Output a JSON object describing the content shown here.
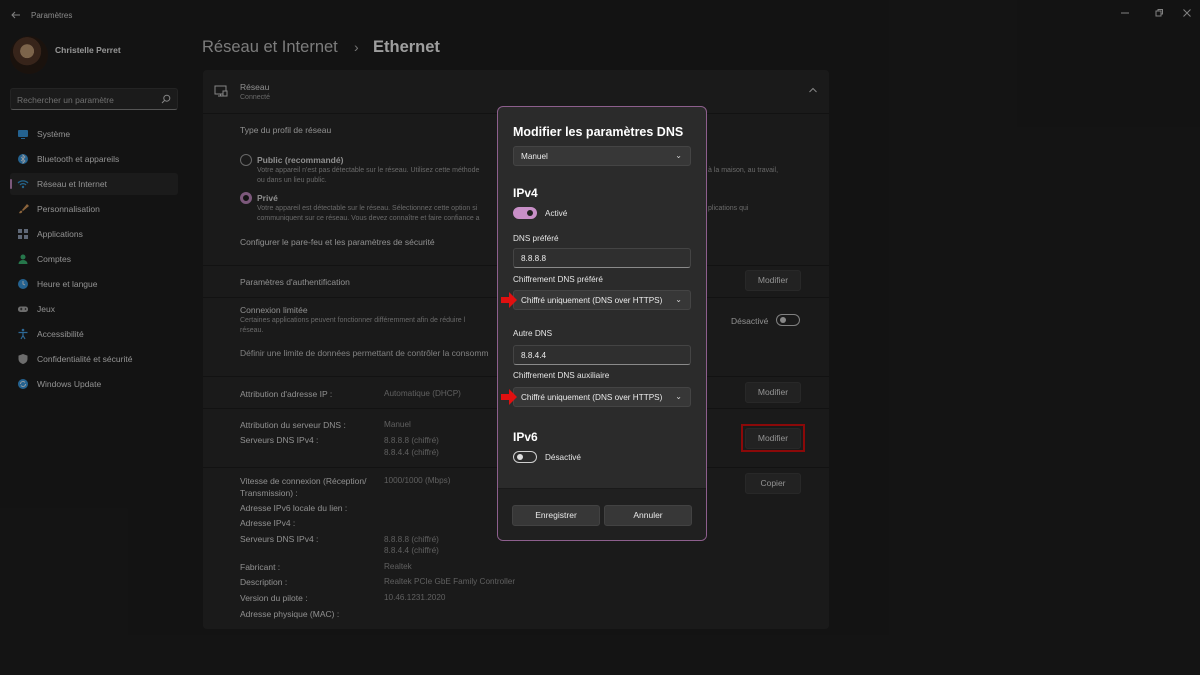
{
  "window": {
    "title": "Paramètres"
  },
  "user": {
    "name": "Christelle Perret"
  },
  "search": {
    "placeholder": "Rechercher un paramètre"
  },
  "sidebar": {
    "items": [
      {
        "label": "Système",
        "icon": "system-icon",
        "color": "#3a9fe8"
      },
      {
        "label": "Bluetooth et appareils",
        "icon": "bluetooth-icon",
        "color": "#3a9fe8"
      },
      {
        "label": "Réseau et Internet",
        "icon": "wifi-icon",
        "color": "#3aa3e3"
      },
      {
        "label": "Personnalisation",
        "icon": "brush-icon",
        "color": "#e0a060"
      },
      {
        "label": "Applications",
        "icon": "apps-icon",
        "color": "#9aa8c0"
      },
      {
        "label": "Comptes",
        "icon": "person-icon",
        "color": "#3ec07a"
      },
      {
        "label": "Heure et langue",
        "icon": "globe-clock-icon",
        "color": "#3a9fe8"
      },
      {
        "label": "Jeux",
        "icon": "gamepad-icon",
        "color": "#b0b0b0"
      },
      {
        "label": "Accessibilité",
        "icon": "accessibility-icon",
        "color": "#4aa8f0"
      },
      {
        "label": "Confidentialité et sécurité",
        "icon": "shield-icon",
        "color": "#b0b0b0"
      },
      {
        "label": "Windows Update",
        "icon": "update-icon",
        "color": "#3a9fe8"
      }
    ],
    "active_index": 2
  },
  "header": {
    "breadcrumb_parent": "Réseau et Internet",
    "separator": "›",
    "current": "Ethernet"
  },
  "network": {
    "title": "Réseau",
    "status": "Connecté",
    "profile_heading": "Type du profil de réseau",
    "public_label": "Public (recommandé)",
    "public_desc1": "Votre appareil n'est pas détectable sur le réseau. Utilisez cette méthode",
    "public_desc1_tail": "à la maison, au travail,",
    "public_desc2": "ou dans un lieu public.",
    "private_label": "Privé",
    "private_desc1": "Votre appareil est détectable sur le réseau. Sélectionnez cette option si",
    "private_desc1_tail": "plications qui",
    "private_desc2": "communiquent sur ce réseau. Vous devez connaître et faire confiance a",
    "firewall_link": "Configurer le pare-feu et les paramètres de sécurité",
    "auth_label": "Paramètres d'authentification",
    "auth_button": "Modifier",
    "metered_label": "Connexion limitée",
    "metered_desc1": "Certaines applications peuvent fonctionner différemment afin de réduire l",
    "metered_desc2": "réseau.",
    "metered_state": "Désactivé",
    "data_limit_link": "Définir une limite de données permettant de contrôler la consomm",
    "ip_label": "Attribution d'adresse IP :",
    "ip_value": "Automatique (DHCP)",
    "ip_button": "Modifier",
    "dns_assign_label": "Attribution du serveur DNS :",
    "dns_assign_value": "Manuel",
    "dns_servers_label": "Serveurs DNS IPv4 :",
    "dns_server_1": "8.8.8.8 (chiffré)",
    "dns_server_2": "8.8.4.4 (chiffré)",
    "dns_button": "Modifier",
    "speed_label_1": "Vitesse de connexion (Réception/",
    "speed_label_2": "Transmission) :",
    "speed_value": "1000/1000 (Mbps)",
    "copy_button": "Copier",
    "ipv6_local_label": "Adresse IPv6 locale du lien :",
    "ipv4_label": "Adresse IPv4 :",
    "dns_servers_label_2": "Serveurs DNS IPv4 :",
    "dns2_server_1": "8.8.8.8 (chiffré)",
    "dns2_server_2": "8.8.4.4 (chiffré)",
    "manufacturer_label": "Fabricant :",
    "manufacturer_value": "Realtek",
    "description_label": "Description :",
    "description_value": "Realtek PCIe GbE Family Controller",
    "driver_label": "Version du pilote :",
    "driver_value": "10.46.1231.2020",
    "mac_label": "Adresse physique (MAC) :"
  },
  "dialog": {
    "title": "Modifier les paramètres DNS",
    "mode": "Manuel",
    "ipv4_heading": "IPv4",
    "ipv4_toggle_label": "Activé",
    "ipv4_on": true,
    "preferred_label": "DNS préféré",
    "preferred_value": "8.8.8.8",
    "preferred_enc_label": "Chiffrement DNS préféré",
    "preferred_enc_value": "Chiffré uniquement (DNS over HTTPS)",
    "alt_label": "Autre DNS",
    "alt_value": "8.8.4.4",
    "alt_enc_label": "Chiffrement DNS auxiliaire",
    "alt_enc_value": "Chiffré uniquement (DNS over HTTPS)",
    "ipv6_heading": "IPv6",
    "ipv6_toggle_label": "Désactivé",
    "ipv6_on": false,
    "save_button": "Enregistrer",
    "cancel_button": "Annuler"
  },
  "colors": {
    "accent": "#c88fc7",
    "annotation_red": "#e01010",
    "background": "#202020",
    "card": "#2b2b2b"
  }
}
